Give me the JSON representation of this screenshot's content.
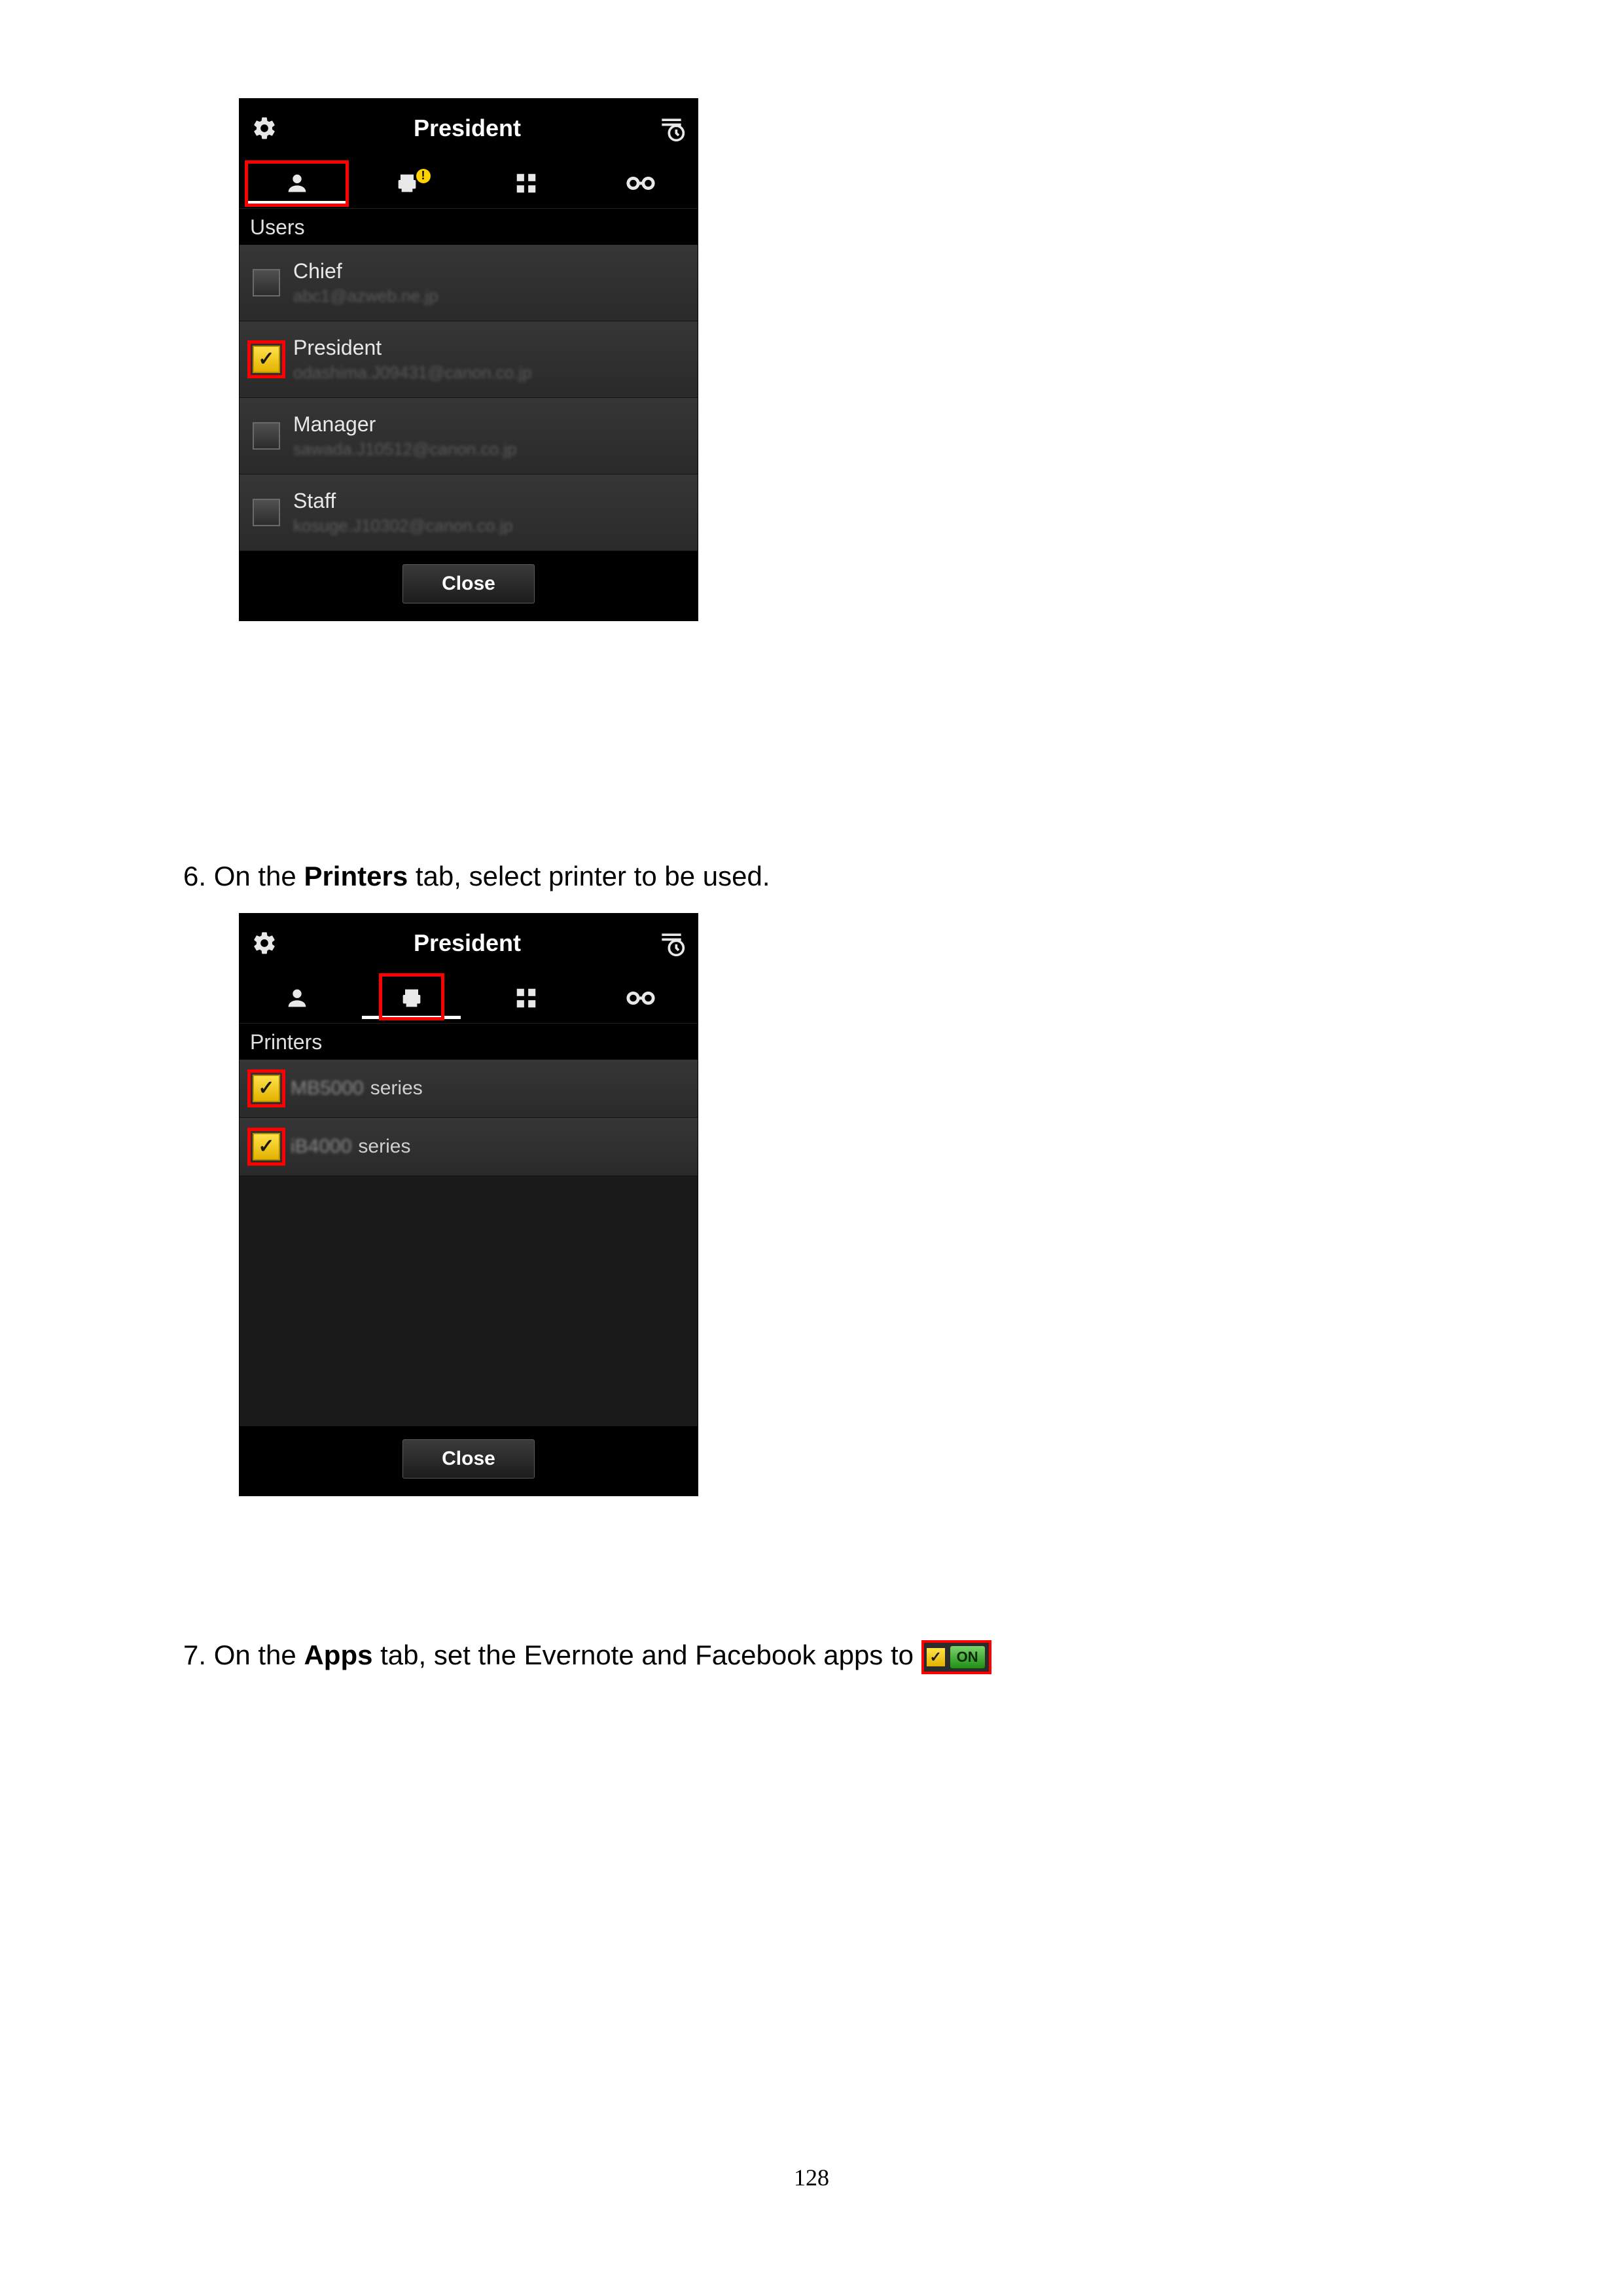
{
  "page_number": "128",
  "panel1": {
    "title": "President",
    "section_label": "Users",
    "close_label": "Close",
    "users": [
      {
        "name": "Chief",
        "sub": "abc1@azweb.ne.jp",
        "checked": false,
        "highlight": false
      },
      {
        "name": "President",
        "sub": "odashima.J09431@canon.co.jp",
        "checked": true,
        "highlight": true
      },
      {
        "name": "Manager",
        "sub": "sawada.J10512@canon.co.jp",
        "checked": false,
        "highlight": false
      },
      {
        "name": "Staff",
        "sub": "kosuge.J10302@canon.co.jp",
        "checked": false,
        "highlight": false
      }
    ]
  },
  "step6": {
    "prefix": "6.  On the ",
    "bold": "Printers",
    "suffix": " tab, select printer to be used."
  },
  "panel2": {
    "title": "President",
    "section_label": "Printers",
    "close_label": "Close",
    "printers": [
      {
        "model_blur": "MB5000",
        "suffix": "series",
        "checked": true,
        "highlight": true
      },
      {
        "model_blur": "iB4000",
        "suffix": "series",
        "checked": true,
        "highlight": true
      }
    ]
  },
  "step7": {
    "prefix": "7.  On the ",
    "bold": "Apps",
    "suffix": " tab, set the Evernote and Facebook apps to ",
    "badge_label": "ON"
  }
}
